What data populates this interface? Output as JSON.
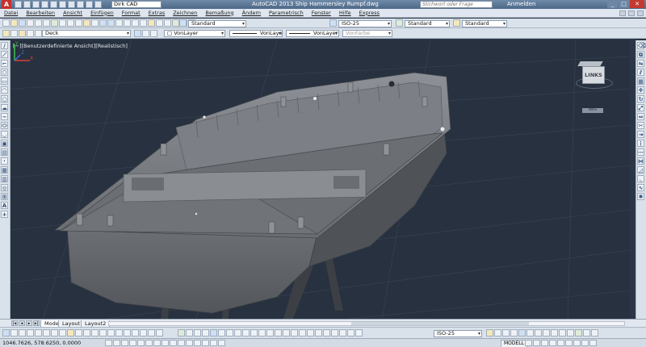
{
  "titlebar": {
    "app_icon": "A",
    "workspace": "Dirk CAD",
    "title": "AutoCAD 2013    Ship Hammersley Rumpf.dwg",
    "search_placeholder": "Stichwort oder Frage eingeben",
    "login": "Anmelden"
  },
  "menu": [
    "Datei",
    "Bearbeiten",
    "Ansicht",
    "Einfügen",
    "Format",
    "Extras",
    "Zeichnen",
    "Bemaßung",
    "Ändern",
    "Parametrisch",
    "Fenster",
    "Hilfe",
    "Express"
  ],
  "toolbar1": {
    "textstyle": "Standard",
    "dimstyle": "ISO-25",
    "tablestyle": "Standard",
    "mleaderstyle": "Standard"
  },
  "toolbar2": {
    "layer": "Deck",
    "color": "VonLayer",
    "linetype": "VonLayer",
    "lineweight": "VonLayer",
    "plotstyle": "VonFarbe"
  },
  "viewport": {
    "label": "[−][Benutzerdefinierte Ansicht][Realistisch]",
    "viewcube_face": "LINKS",
    "wcs_label": "WKS"
  },
  "ucs": {
    "x": "X",
    "y": "Y",
    "z": "Z"
  },
  "tabs": [
    "Modell",
    "Layout1",
    "Layout2"
  ],
  "bottom_toolbar": {
    "dimstyle": "ISO-25"
  },
  "status": {
    "coords": "1046.7626, 578.6250, 0.0000",
    "space": "MODELL"
  },
  "colors": {
    "viewport_bg": "#27313f",
    "titlebar": "#4d6887",
    "hull": "#5e6166",
    "deck": "#696c71"
  },
  "icons": {
    "app": "autocad-logo-icon",
    "viewcube": "viewcube-icon",
    "ucs": "ucs-axis-icon"
  }
}
